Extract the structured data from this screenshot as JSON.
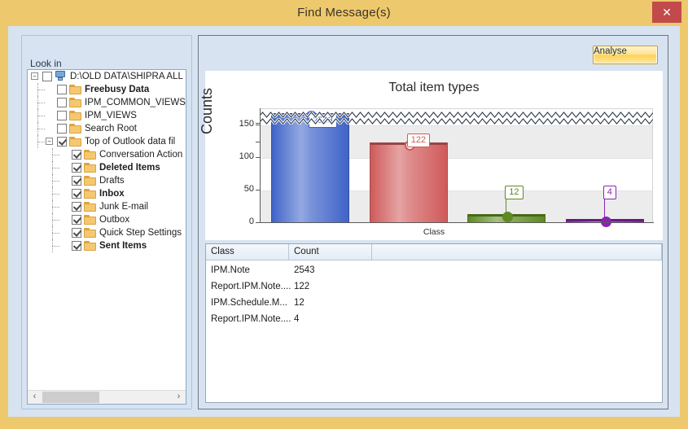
{
  "window": {
    "title": "Find Message(s)",
    "close_label": "✕"
  },
  "lookin": {
    "legend": "Look in",
    "tree": [
      {
        "label": "D:\\OLD DATA\\SHIPRA ALL D",
        "bold": false,
        "checked": false,
        "depth": 0,
        "expander": "−",
        "icon": "computer-icon"
      },
      {
        "label": "Freebusy Data",
        "bold": true,
        "checked": false,
        "depth": 1,
        "expander": "",
        "icon": "folder-icon"
      },
      {
        "label": "IPM_COMMON_VIEWS",
        "bold": false,
        "checked": false,
        "depth": 1,
        "expander": "",
        "icon": "folder-icon"
      },
      {
        "label": "IPM_VIEWS",
        "bold": false,
        "checked": false,
        "depth": 1,
        "expander": "",
        "icon": "folder-icon"
      },
      {
        "label": "Search Root",
        "bold": false,
        "checked": false,
        "depth": 1,
        "expander": "",
        "icon": "folder-icon"
      },
      {
        "label": "Top of Outlook data fil",
        "bold": false,
        "checked": true,
        "depth": 1,
        "expander": "−",
        "icon": "folder-icon"
      },
      {
        "label": "Conversation Action",
        "bold": false,
        "checked": true,
        "depth": 2,
        "expander": "",
        "icon": "folder-icon"
      },
      {
        "label": "Deleted Items",
        "bold": true,
        "checked": true,
        "depth": 2,
        "expander": "",
        "icon": "folder-icon"
      },
      {
        "label": "Drafts",
        "bold": false,
        "checked": true,
        "depth": 2,
        "expander": "",
        "icon": "folder-icon"
      },
      {
        "label": "Inbox",
        "bold": true,
        "checked": true,
        "depth": 2,
        "expander": "",
        "icon": "folder-icon"
      },
      {
        "label": "Junk E-mail",
        "bold": false,
        "checked": true,
        "depth": 2,
        "expander": "",
        "icon": "folder-icon"
      },
      {
        "label": "Outbox",
        "bold": false,
        "checked": true,
        "depth": 2,
        "expander": "",
        "icon": "folder-icon"
      },
      {
        "label": "Quick Step Settings",
        "bold": false,
        "checked": true,
        "depth": 2,
        "expander": "",
        "icon": "folder-icon"
      },
      {
        "label": "Sent Items",
        "bold": true,
        "checked": true,
        "depth": 2,
        "expander": "",
        "icon": "folder-icon"
      }
    ],
    "scrollbar": {
      "left_arrow": "‹",
      "right_arrow": "›"
    }
  },
  "toolbar": {
    "analyse_label": "Analyse"
  },
  "chart_data": {
    "type": "bar",
    "title": "Total item types",
    "xlabel": "Class",
    "ylabel": "Counts",
    "categories": [
      "IPM.Note",
      "Report.IPM.Note....",
      "IPM.Schedule.M...",
      "Report.IPM.Note...."
    ],
    "values": [
      2543,
      122,
      12,
      4
    ],
    "data_labels": [
      "2543",
      "122",
      "12",
      "4"
    ],
    "colors": [
      "#3f63c8",
      "#d05a5a",
      "#5e8a21",
      "#8b22b5"
    ],
    "yticks": [
      "0",
      "50",
      "100",
      "150"
    ],
    "ylim": [
      0,
      175
    ],
    "axis_break": {
      "enabled": true,
      "style": "zigzag",
      "at": 160
    },
    "grid": true,
    "legend": "none"
  },
  "table": {
    "columns": [
      "Class",
      "Count",
      ""
    ],
    "rows": [
      {
        "class": "IPM.Note",
        "count": "2543"
      },
      {
        "class": "Report.IPM.Note....",
        "count": "122"
      },
      {
        "class": "IPM.Schedule.M...",
        "count": "12"
      },
      {
        "class": "Report.IPM.Note....",
        "count": "4"
      }
    ]
  },
  "colors": {
    "titlebar": "#eec86c",
    "client": "#d7e3f1",
    "close": "#c24a4a",
    "accent": "#ffd257"
  }
}
